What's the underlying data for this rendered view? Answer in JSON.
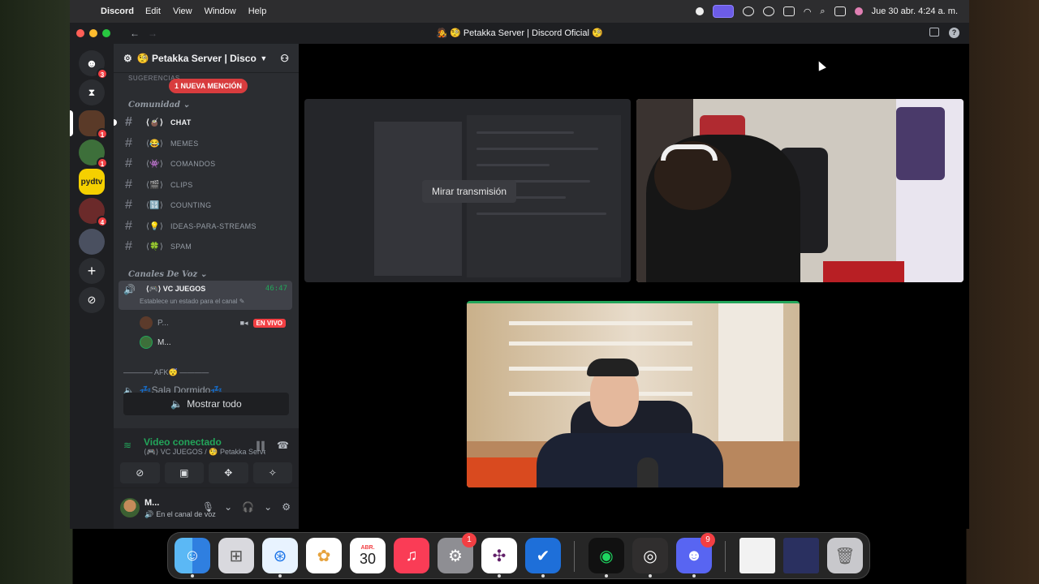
{
  "menubar": {
    "app": "Discord",
    "items": [
      "Edit",
      "View",
      "Window",
      "Help"
    ],
    "datetime": "Jue 30 abr.  4:24 a. m."
  },
  "window": {
    "title": "🧑‍🎤 🧐 Petakka Server | Discord Oficial 🧐"
  },
  "rail": {
    "dm_badge": "3",
    "servers": [
      {
        "badge": "1"
      },
      {
        "badge": "1"
      },
      {
        "label": "pydtv"
      },
      {
        "badge": "4"
      },
      {}
    ]
  },
  "server": {
    "name": "🧐 Petakka Server | Disco..."
  },
  "channels": {
    "top_partial": "SUGERENCIAS",
    "mention_pill": "1 NUEVA MENCIÓN",
    "category_comunidad": "Comunidad",
    "text_channels": [
      {
        "deco": "⟨🧉⟩",
        "name": "CHAT"
      },
      {
        "deco": "⟨😂⟩",
        "name": "MEMES"
      },
      {
        "deco": "⟨👾⟩",
        "name": "COMANDOS"
      },
      {
        "deco": "⟨🎬⟩",
        "name": "CLIPS"
      },
      {
        "deco": "⟨🔢⟩",
        "name": "COUNTING"
      },
      {
        "deco": "⟨💡⟩",
        "name": "IDEAS-PARA-STREAMS"
      },
      {
        "deco": "⟨🍀⟩",
        "name": "SPAM"
      }
    ],
    "category_voz": "Canales De Voz",
    "voice_channel": {
      "deco": "⟨🎮⟩",
      "name": "VC JUEGOS",
      "time": "46:47",
      "status": "Establece un estado para el canal ✎"
    },
    "voice_users": [
      {
        "name": "P...",
        "live": "EN VIVO"
      },
      {
        "name": "M..."
      }
    ],
    "afk_category": "———— AFK😴 ————",
    "afk_channel": "💤Sala Dormido💤",
    "show_all": "Mostrar todo"
  },
  "voice_panel": {
    "title": "Video conectado",
    "subtitle": "⟨🎮⟩ VC JUEGOS / 🧐 Petakka Server | Di..."
  },
  "user_panel": {
    "name": "M...",
    "status": "En el canal de voz"
  },
  "stage": {
    "watch_button": "Mirar transmisión"
  },
  "dock": {
    "calendar_month": "ABR.",
    "calendar_day": "30",
    "settings_badge": "1",
    "discord_badge": "9"
  },
  "colors": {
    "discord_green": "#23a55a",
    "discord_red": "#f23f43",
    "sidebar_bg": "#2b2d31"
  }
}
